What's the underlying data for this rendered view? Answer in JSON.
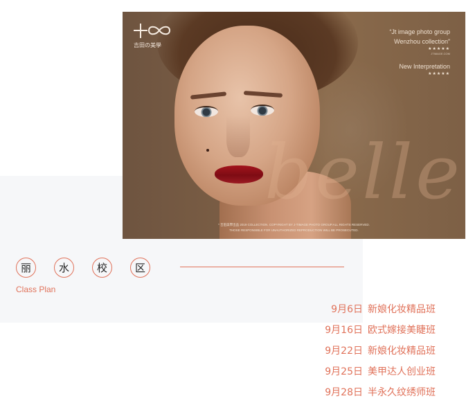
{
  "photo": {
    "logo_caption": "吉田の美學",
    "tagline": {
      "line1": "“Jt image photo group",
      "line2": "Wenzhou collection”",
      "stars1": "★★★★★",
      "small": "JTIMAGE.COM",
      "line3": "New Interpretation",
      "stars2": "★★★★★"
    },
    "script_text": "belle",
    "copyright_line1": "* 吉田美學出品 2019 COLLECTION. COPYRIGHT BY J-TIMAGE PHOTO GROUP.ALL RIGHTS RESERVED.",
    "copyright_line2": "THOSE RESPONSIBLE FOR UNAUTHORIZED REPRODUCTION WILL BE PROSECUTED."
  },
  "campus": {
    "chars": [
      "丽",
      "水",
      "校",
      "区"
    ],
    "subtitle": "Class Plan"
  },
  "schedule": [
    {
      "date": "9月6日",
      "course": "新娘化妆精品班"
    },
    {
      "date": "9月16日",
      "course": "欧式嫁接美睫班"
    },
    {
      "date": "9月22日",
      "course": "新娘化妆精品班"
    },
    {
      "date": "9月25日",
      "course": "美甲达人创业班"
    },
    {
      "date": "9月28日",
      "course": "半永久纹绣师班"
    }
  ],
  "colors": {
    "accent": "#e07159",
    "panel": "#f6f7f9"
  }
}
